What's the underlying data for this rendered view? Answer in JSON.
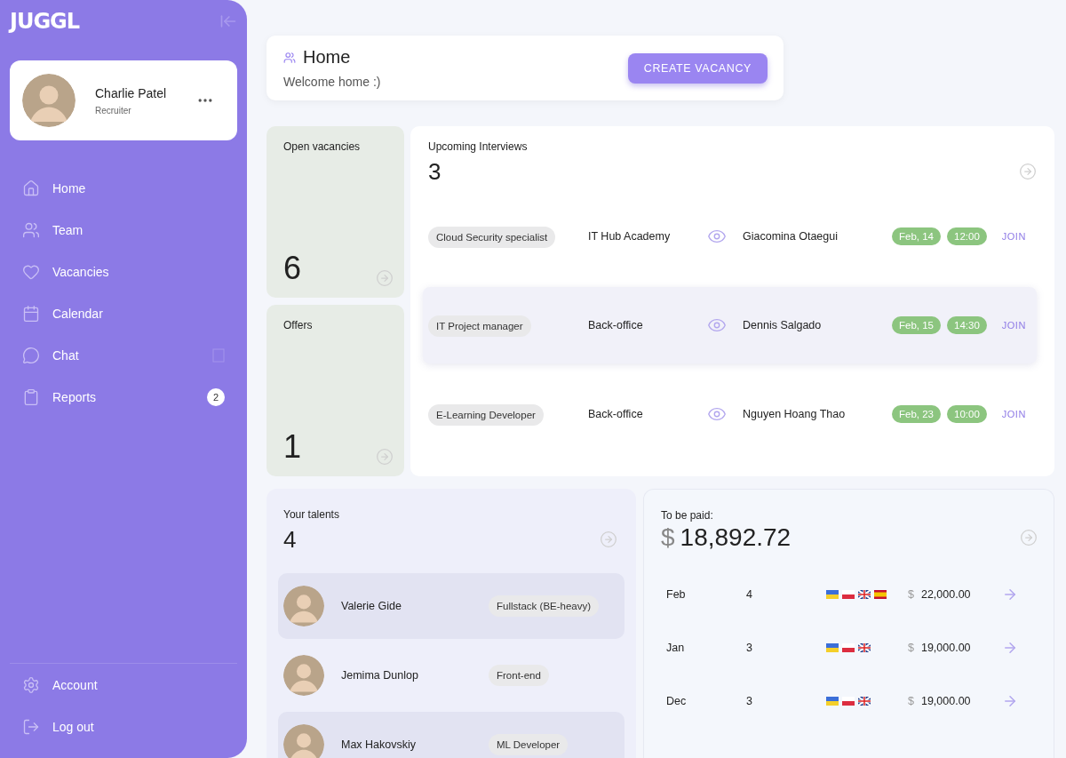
{
  "sidebar": {
    "logo": "JUGGL",
    "profile": {
      "name": "Charlie Patel",
      "role": "Recruiter"
    },
    "items": [
      {
        "kind": "home",
        "label": "Home"
      },
      {
        "kind": "team",
        "label": "Team"
      },
      {
        "kind": "heart",
        "label": "Vacancies"
      },
      {
        "kind": "calendar",
        "label": "Calendar"
      },
      {
        "kind": "chat",
        "label": "Chat",
        "indicator": {
          "kind": "square"
        }
      },
      {
        "kind": "clipboard",
        "label": "Reports",
        "badge": "2"
      }
    ],
    "bottom_items": [
      {
        "kind": "gear",
        "label": "Account"
      },
      {
        "kind": "logout",
        "label": "Log out"
      }
    ]
  },
  "header": {
    "title": "Home",
    "subtitle": "Welcome home :)",
    "button": "CREATE VACANCY"
  },
  "stats": [
    {
      "label": "Open vacancies",
      "value": "6"
    },
    {
      "label": "Offers",
      "value": "1"
    }
  ],
  "interviews": {
    "title": "Upcoming Interviews",
    "count": "3",
    "rows": [
      {
        "position": "Cloud Security specialist",
        "company": "IT Hub Academy",
        "candidate": "Giacomina Otaegui",
        "date": "Feb, 14",
        "time": "12:00",
        "action": "JOIN",
        "selected": false
      },
      {
        "position": "IT Project manager",
        "company": "Back-office",
        "candidate": "Dennis Salgado",
        "date": "Feb, 15",
        "time": "14:30",
        "action": "JOIN",
        "selected": true
      },
      {
        "position": "E-Learning Developer",
        "company": "Back-office",
        "candidate": "Nguyen Hoang Thao",
        "date": "Feb, 23",
        "time": "10:00",
        "action": "JOIN",
        "selected": false
      }
    ]
  },
  "talents": {
    "title": "Your talents",
    "count": "4",
    "rows": [
      {
        "name": "Valerie Gide",
        "role": "Fullstack (BE-heavy)",
        "selected": true
      },
      {
        "name": "Jemima Dunlop",
        "role": "Front-end",
        "selected": false
      },
      {
        "name": "Max Hakovskiy",
        "role": "ML Developer",
        "selected": true
      }
    ]
  },
  "payments": {
    "title": "To be paid:",
    "currency": "$",
    "total": "18,892.72",
    "rows": [
      {
        "month": "Feb",
        "count": "4",
        "flags": [
          {
            "kind": "ua"
          },
          {
            "kind": "pl"
          },
          {
            "kind": "gb"
          },
          {
            "kind": "es"
          }
        ],
        "currency": "$",
        "amount": "22,000.00"
      },
      {
        "month": "Jan",
        "count": "3",
        "flags": [
          {
            "kind": "ua"
          },
          {
            "kind": "pl"
          },
          {
            "kind": "gb"
          }
        ],
        "currency": "$",
        "amount": "19,000.00"
      },
      {
        "month": "Dec",
        "count": "3",
        "flags": [
          {
            "kind": "ua"
          },
          {
            "kind": "pl"
          },
          {
            "kind": "gb"
          }
        ],
        "currency": "$",
        "amount": "19,000.00"
      }
    ]
  }
}
